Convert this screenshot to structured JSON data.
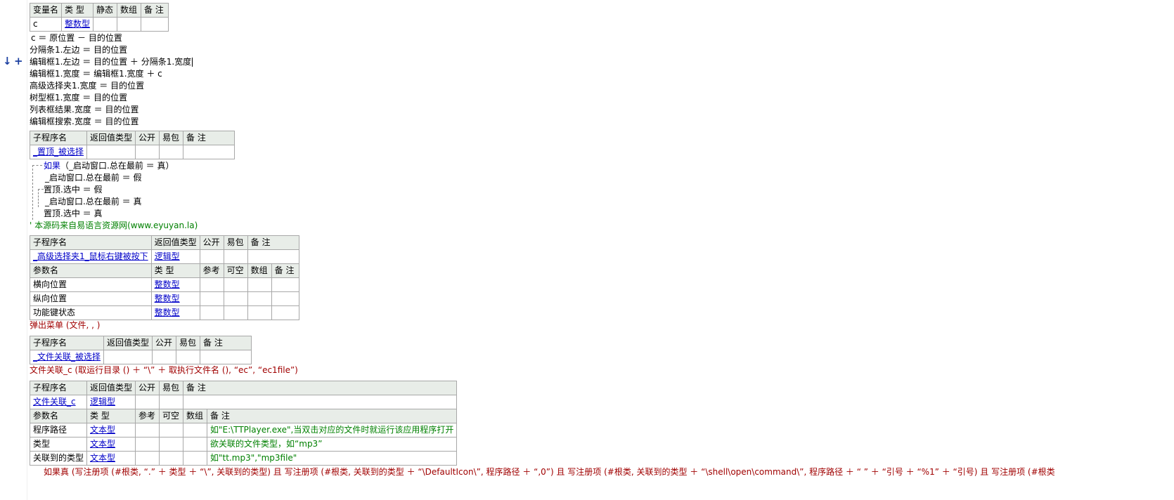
{
  "gutter": {
    "arrow_icon": "arrow-down-icon",
    "plus_icon": "plus-icon",
    "arrow_glyph": "↓",
    "plus_glyph": "+"
  },
  "var_table": {
    "headers": [
      "变量名",
      "类 型",
      "静态",
      "数组",
      "备 注"
    ],
    "row": {
      "name": "c",
      "type": "整数型"
    }
  },
  "code_lines_1": [
    "c ＝ 原位置 － 目的位置",
    "分隔条1.左边 ＝ 目的位置",
    "编辑框1.左边 ＝ 目的位置 ＋ 分隔条1.宽度",
    "编辑框1.宽度 ＝ 编辑框1.宽度 ＋ c",
    "高级选择夹1.宽度 ＝ 目的位置",
    "树型框1.宽度 ＝ 目的位置",
    "列表框结果.宽度 ＝ 目的位置",
    "编辑框搜索.宽度 ＝ 目的位置"
  ],
  "sub1": {
    "headers": [
      "子程序名",
      "返回值类型",
      "公开",
      "易包",
      "备 注"
    ],
    "name": "_置顶_被选择"
  },
  "sub1_code": {
    "if_kw": "如果",
    "if_cond": "（_启动窗口.总在最前 ＝ 真）",
    "line1": "_启动窗口.总在最前 ＝ 假",
    "line2": "置顶.选中 ＝ 假",
    "line3": "_启动窗口.总在最前 ＝ 真",
    "line4": "置顶.选中 ＝ 真",
    "comment": "' 本源码来自易语言资源网(www.eyuyan.la)"
  },
  "sub2": {
    "headers": [
      "子程序名",
      "返回值类型",
      "公开",
      "易包",
      "备 注"
    ],
    "name": "_高级选择夹1_鼠标右键被按下",
    "ret": "逻辑型",
    "param_headers": [
      "参数名",
      "类 型",
      "参考",
      "可空",
      "数组",
      "备 注"
    ],
    "params": [
      {
        "name": "横向位置",
        "type": "整数型"
      },
      {
        "name": "纵向位置",
        "type": "整数型"
      },
      {
        "name": "功能键状态",
        "type": "整数型"
      }
    ],
    "code": "弹出菜单 (文件, , )"
  },
  "sub3": {
    "headers": [
      "子程序名",
      "返回值类型",
      "公开",
      "易包",
      "备 注"
    ],
    "name": "_文件关联_被选择",
    "code": "文件关联_c (取运行目录 () ＋ “\\” ＋ 取执行文件名 (), “ec”, “ec1file”)"
  },
  "sub4": {
    "headers": [
      "子程序名",
      "返回值类型",
      "公开",
      "易包",
      "备 注"
    ],
    "name": "文件关联_c",
    "ret": "逻辑型",
    "param_headers": [
      "参数名",
      "类 型",
      "参考",
      "可空",
      "数组",
      "备 注"
    ],
    "params": [
      {
        "name": "程序路径",
        "type": "文本型",
        "note": "如\"E:\\TTPlayer.exe\",当双击对应的文件时就运行该应用程序打开"
      },
      {
        "name": "类型",
        "type": "文本型",
        "note": "欲关联的文件类型，如“mp3”"
      },
      {
        "name": "关联到的类型",
        "type": "文本型",
        "note": "如\"tt.mp3\",\"mp3file\""
      }
    ],
    "bottom_code": "如果真 (写注册项 (#根类, “.” ＋ 类型 ＋ “\\”, 关联到的类型) 且 写注册项 (#根类, 关联到的类型 ＋ “\\DefaultIcon\\”, 程序路径 ＋ “,0”) 且 写注册项 (#根类, 关联到的类型 ＋ “\\shell\\open\\command\\”, 程序路径 ＋ “ ” ＋ “引号 ＋ “%1” ＋ “引号) 且 写注册项 (#根类"
  },
  "colors": {
    "header_bg": "#e8ede8",
    "link_blue": "#0000c8",
    "comment_green": "#008000",
    "call_red": "#a00000"
  }
}
